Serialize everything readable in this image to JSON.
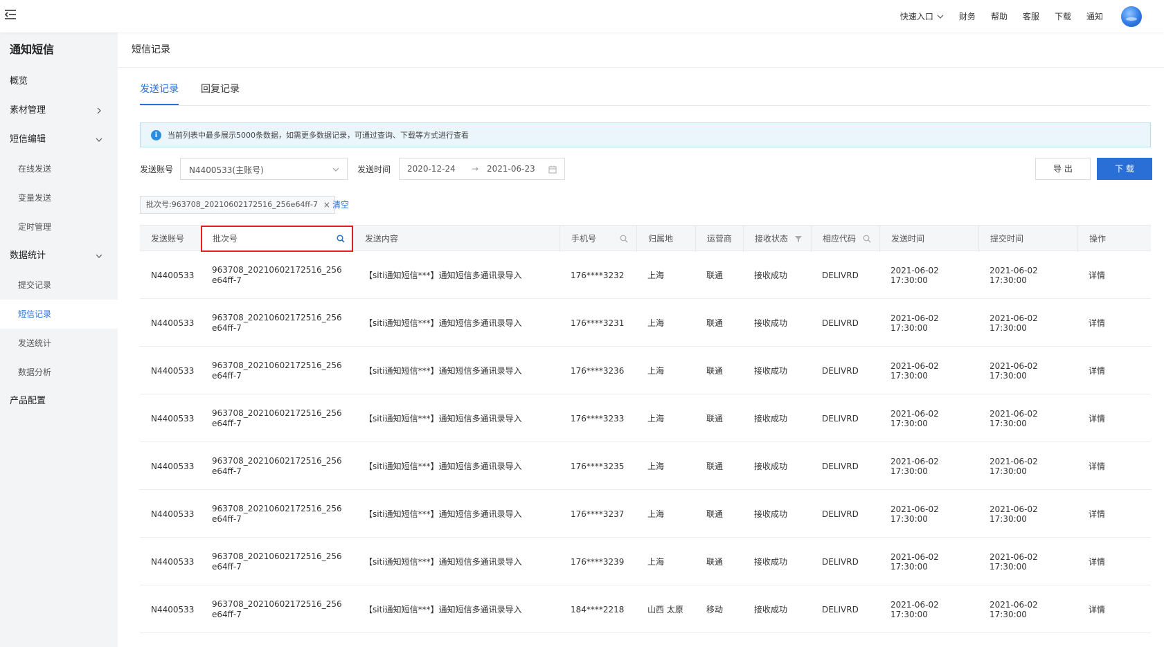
{
  "topbar": {
    "nav": [
      "快速入口",
      "财务",
      "帮助",
      "客服",
      "下载",
      "通知"
    ]
  },
  "sidebar": {
    "title": "通知短信",
    "items": [
      {
        "label": "概览",
        "type": "item"
      },
      {
        "label": "素材管理",
        "type": "item",
        "chevron": "right"
      },
      {
        "label": "短信编辑",
        "type": "item",
        "chevron": "down"
      },
      {
        "label": "在线发送",
        "type": "sub"
      },
      {
        "label": "变量发送",
        "type": "sub"
      },
      {
        "label": "定时管理",
        "type": "sub"
      },
      {
        "label": "数据统计",
        "type": "item",
        "chevron": "down"
      },
      {
        "label": "提交记录",
        "type": "sub"
      },
      {
        "label": "短信记录",
        "type": "sub",
        "active": true
      },
      {
        "label": "发送统计",
        "type": "sub"
      },
      {
        "label": "数据分析",
        "type": "sub"
      },
      {
        "label": "产品配置",
        "type": "item"
      }
    ]
  },
  "page": {
    "title": "短信记录",
    "tabs": [
      {
        "label": "发送记录",
        "active": true
      },
      {
        "label": "回复记录",
        "active": false
      }
    ],
    "notice": "当前列表中最多展示5000条数据，如需更多数据记录，可通过查询、下载等方式进行查看",
    "filters": {
      "account_label": "发送账号",
      "account_value": "N4400533(主账号)",
      "time_label": "发送时间",
      "date_start": "2020-12-24",
      "date_sep": "→",
      "date_end": "2021-06-23",
      "export_label": "导 出",
      "download_label": "下 载"
    },
    "chip": "批次号:963708_20210602172516_256e64ff-7",
    "chip_close": "×",
    "clear_label": "清空"
  },
  "table": {
    "columns": [
      "发送账号",
      "批次号",
      "发送内容",
      "手机号",
      "归属地",
      "运营商",
      "接收状态",
      "相应代码",
      "发送时间",
      "提交时间",
      "操作"
    ],
    "rows": [
      [
        "N4400533",
        "963708_20210602172516_256e64ff-7",
        "【siti通知短信***】通知短信多通讯录导入",
        "176****3232",
        "上海",
        "联通",
        "接收成功",
        "DELIVRD",
        "2021-06-02 17:30:00",
        "2021-06-02 17:30:00",
        "详情"
      ],
      [
        "N4400533",
        "963708_20210602172516_256e64ff-7",
        "【siti通知短信***】通知短信多通讯录导入",
        "176****3231",
        "上海",
        "联通",
        "接收成功",
        "DELIVRD",
        "2021-06-02 17:30:00",
        "2021-06-02 17:30:00",
        "详情"
      ],
      [
        "N4400533",
        "963708_20210602172516_256e64ff-7",
        "【siti通知短信***】通知短信多通讯录导入",
        "176****3236",
        "上海",
        "联通",
        "接收成功",
        "DELIVRD",
        "2021-06-02 17:30:00",
        "2021-06-02 17:30:00",
        "详情"
      ],
      [
        "N4400533",
        "963708_20210602172516_256e64ff-7",
        "【siti通知短信***】通知短信多通讯录导入",
        "176****3233",
        "上海",
        "联通",
        "接收成功",
        "DELIVRD",
        "2021-06-02 17:30:00",
        "2021-06-02 17:30:00",
        "详情"
      ],
      [
        "N4400533",
        "963708_20210602172516_256e64ff-7",
        "【siti通知短信***】通知短信多通讯录导入",
        "176****3235",
        "上海",
        "联通",
        "接收成功",
        "DELIVRD",
        "2021-06-02 17:30:00",
        "2021-06-02 17:30:00",
        "详情"
      ],
      [
        "N4400533",
        "963708_20210602172516_256e64ff-7",
        "【siti通知短信***】通知短信多通讯录导入",
        "176****3237",
        "上海",
        "联通",
        "接收成功",
        "DELIVRD",
        "2021-06-02 17:30:00",
        "2021-06-02 17:30:00",
        "详情"
      ],
      [
        "N4400533",
        "963708_20210602172516_256e64ff-7",
        "【siti通知短信***】通知短信多通讯录导入",
        "176****3239",
        "上海",
        "联通",
        "接收成功",
        "DELIVRD",
        "2021-06-02 17:30:00",
        "2021-06-02 17:30:00",
        "详情"
      ],
      [
        "N4400533",
        "963708_20210602172516_256e64ff-7",
        "【siti通知短信***】通知短信多通讯录导入",
        "184****2218",
        "山西 太原",
        "移动",
        "接收成功",
        "DELIVRD",
        "2021-06-02 17:30:00",
        "2021-06-02 17:30:00",
        "详情"
      ]
    ]
  }
}
